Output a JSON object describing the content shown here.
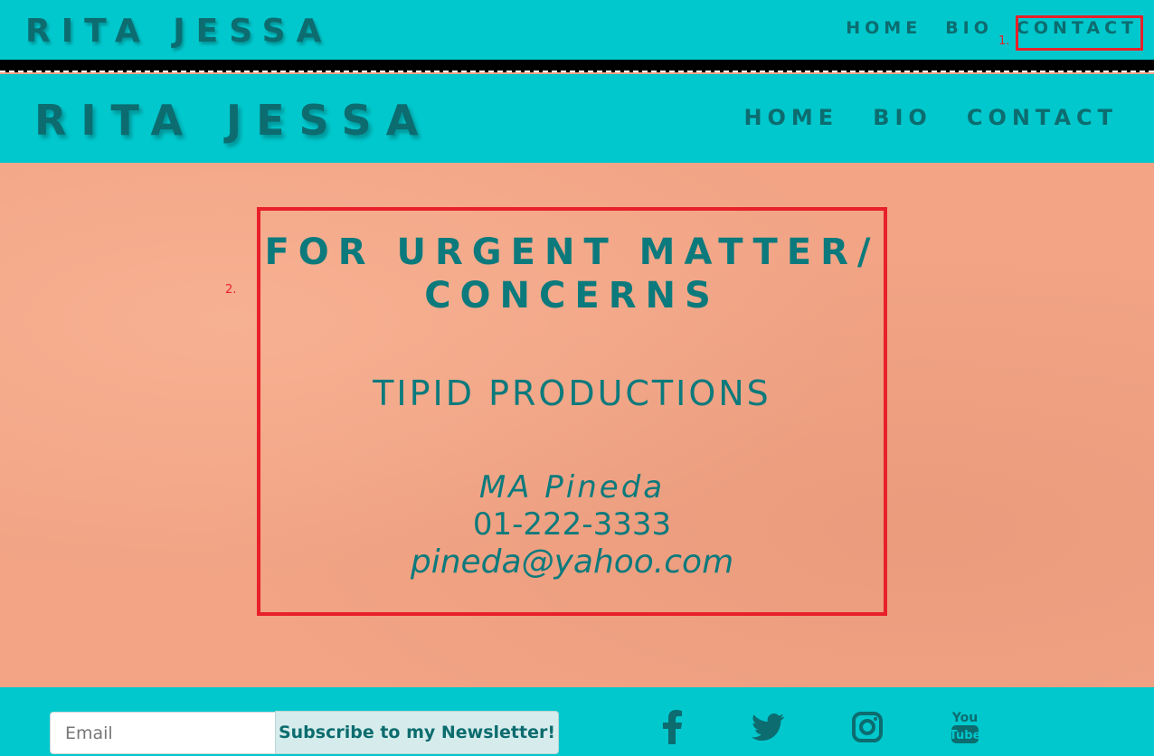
{
  "top_bar": {
    "logo": "RITA JESSA",
    "nav": [
      "HOME",
      "BIO",
      "CONTACT"
    ]
  },
  "annotations": {
    "one": "1.",
    "two": "2."
  },
  "header": {
    "logo": "RITA JESSA",
    "nav": [
      "HOME",
      "BIO",
      "CONTACT"
    ]
  },
  "contact": {
    "headline_line1": "FOR URGENT MATTER/",
    "headline_line2": "CONCERNS",
    "company": "TIPID PRODUCTIONS",
    "person": "MA Pineda",
    "phone": "01-222-3333",
    "email": "pineda@yahoo.com"
  },
  "footer": {
    "email_placeholder": "Email",
    "subscribe_label": "Subscribe to my Newsletter!",
    "social_icons": [
      "facebook-icon",
      "twitter-icon",
      "instagram-icon",
      "youtube-icon"
    ]
  },
  "colors": {
    "header_bg": "#00c8cd",
    "text_teal": "#0c6c6f",
    "content_bg": "#f2a485",
    "annotation_red": "#e8202a"
  }
}
